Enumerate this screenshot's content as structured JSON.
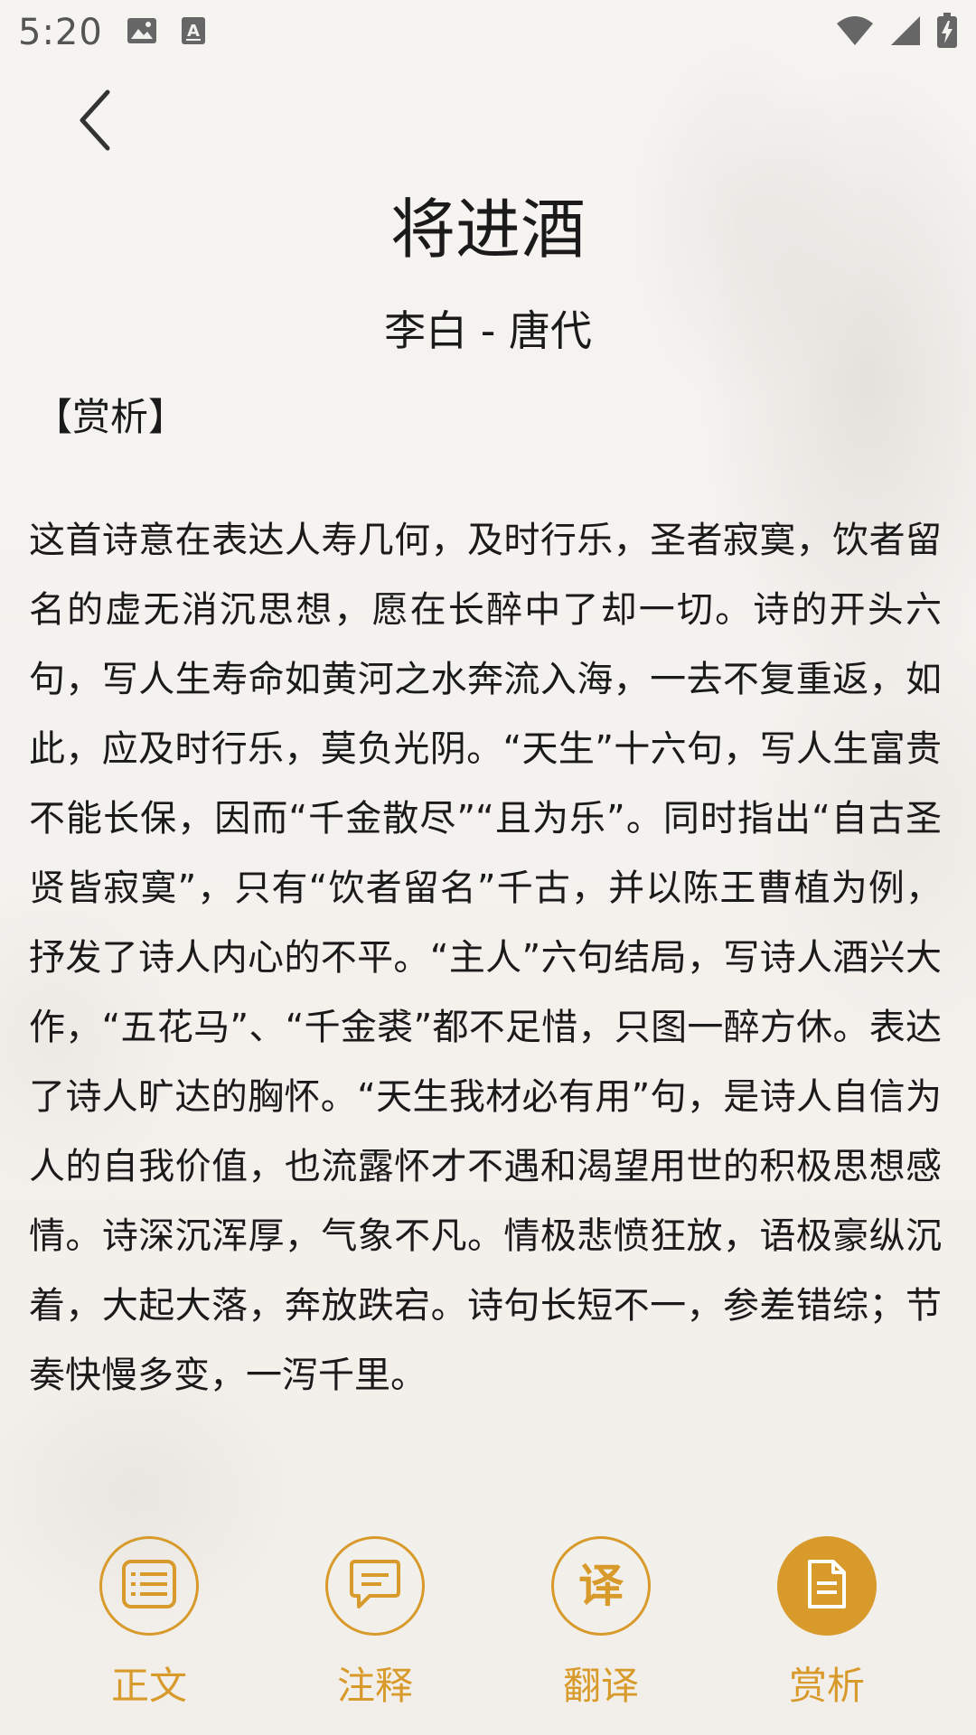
{
  "status_bar": {
    "time": "5:20"
  },
  "poem": {
    "title": "将进酒",
    "author_dynasty": "李白 - 唐代"
  },
  "section": {
    "label": "【赏析】",
    "text": "这首诗意在表达人寿几何，及时行乐，圣者寂寞，饮者留名的虚无消沉思想，愿在长醉中了却一切。诗的开头六句，写人生寿命如黄河之水奔流入海，一去不复重返，如此，应及时行乐，莫负光阴。“天生”十六句，写人生富贵不能长保，因而“千金散尽”“且为乐”。同时指出“自古圣贤皆寂寞”，只有“饮者留名”千古，并以陈王曹植为例，抒发了诗人内心的不平。“主人”六句结局，写诗人酒兴大作，“五花马”、“千金裘”都不足惜，只图一醉方休。表达了诗人旷达的胸怀。“天生我材必有用”句，是诗人自信为人的自我价值，也流露怀才不遇和渴望用世的积极思想感情。诗深沉浑厚，气象不凡。情极悲愤狂放，语极豪纵沉着，大起大落，奔放跌宕。诗句长短不一，参差错综；节奏快慢多变，一泻千里。"
  },
  "bottom_nav": {
    "items": [
      {
        "label": "正文",
        "icon": "list-icon",
        "active": false
      },
      {
        "label": "注释",
        "icon": "comment-icon",
        "active": false
      },
      {
        "label": "翻译",
        "icon": "translate-icon",
        "glyph": "译",
        "active": false
      },
      {
        "label": "赏析",
        "icon": "document-icon",
        "active": true
      }
    ]
  },
  "colors": {
    "accent": "#d89a2a",
    "text": "#1a1a1a",
    "background": "#f4f2ee"
  }
}
